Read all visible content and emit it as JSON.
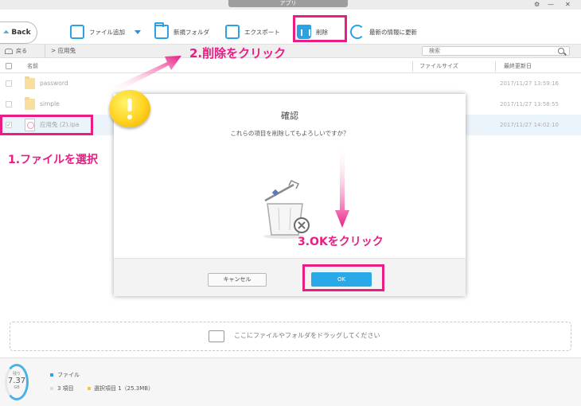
{
  "window": {
    "title": "アプリ",
    "controls": [
      "⚙",
      "—",
      "✕"
    ]
  },
  "toolbar": {
    "back_label": "Back",
    "add_file_label": "ファイル追加",
    "new_folder_label": "新規フォルダ",
    "export_label": "エクスポート",
    "delete_label": "削除",
    "refresh_label": "最新の情報に更新"
  },
  "pathbar": {
    "back_label": "戻る",
    "location": "> 应用兔",
    "search_placeholder": "検索"
  },
  "list": {
    "columns": {
      "name": "名前",
      "size": "ファイルサイズ",
      "modified": "最終更新日"
    },
    "rows": [
      {
        "name": "password",
        "date": "2017/11/27 13:59:16",
        "type": "folder",
        "checked": false
      },
      {
        "name": "simple",
        "date": "2017/11/27 13:58:55",
        "type": "folder",
        "checked": false
      },
      {
        "name": "应用兔 (2).ipa",
        "date": "2017/11/27 14:02:10",
        "type": "ipa",
        "checked": true
      }
    ]
  },
  "dialog": {
    "title": "確認",
    "message": "これらの項目を削除してもよろしいですか？",
    "cancel_label": "キャンセル",
    "ok_label": "OK"
  },
  "annotations": {
    "step1": "1.ファイルを選択",
    "step2": "2.削除をクリック",
    "step3": "3.OKをクリック",
    "highlight_color": "#ea1d84"
  },
  "dropzone": {
    "text": "ここにファイルやフォルダをドラッグしてください"
  },
  "status": {
    "storage_top": "残り",
    "storage_value": "7.37",
    "storage_unit": "GB",
    "category": "ファイル",
    "item_count": "3 項目",
    "selected": "選択項目 1（25.3MB）"
  },
  "colors": {
    "accent": "#2aa2e3",
    "ok_button": "#2aa9e8",
    "selection": "#dcecf7"
  }
}
